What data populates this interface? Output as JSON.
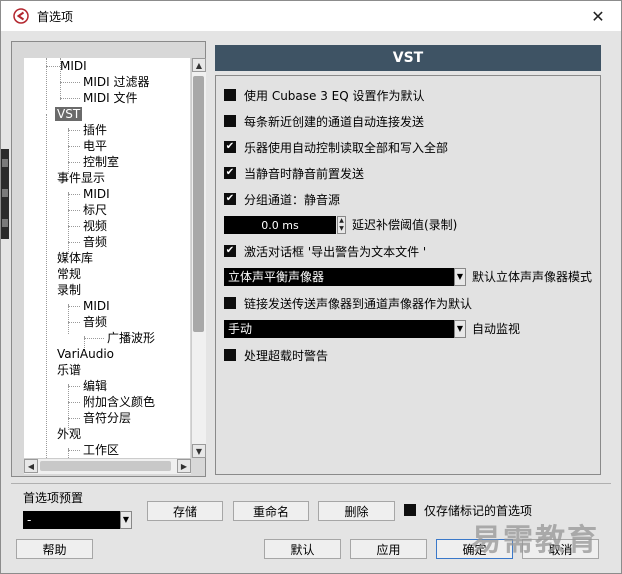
{
  "window": {
    "title": "首选项"
  },
  "tree": {
    "items": [
      "MIDI",
      "MIDI 过滤器",
      "MIDI 文件",
      "VST",
      "插件",
      "电平",
      "控制室",
      "事件显示",
      "MIDI",
      "标尺",
      "视频",
      "音频",
      "媒体库",
      "常规",
      "录制",
      "MIDI",
      "音频",
      "广播波形",
      "VariAudio",
      "乐谱",
      "编辑",
      "附加含义颜色",
      "音符分层",
      "外观",
      "工作区"
    ]
  },
  "vst": {
    "header": "VST",
    "opt1": "使用 Cubase 3 EQ 设置作为默认",
    "opt2": "每条新近创建的通道自动连接发送",
    "opt3": "乐器使用自动控制读取全部和写入全部",
    "opt4": "当静音时静音前置发送",
    "opt5": "分组通道：静音源",
    "delay_value": "0.0 ms",
    "delay_label": "延迟补偿阈值(录制)",
    "opt6": "激活对话框 '导出警告为文本文件 '",
    "panner_value": "立体声平衡声像器",
    "panner_label": "默认立体声声像器模式",
    "opt7": "链接发送传送声像器到通道声像器作为默认",
    "monitor_value": "手动",
    "monitor_label": "自动监视",
    "opt8": "处理超载时警告",
    "checked": {
      "opt1": false,
      "opt2": false,
      "opt3": true,
      "opt4": true,
      "opt5": true,
      "opt6": true,
      "opt7": false,
      "opt8": false
    }
  },
  "presets": {
    "label": "首选项预置",
    "value": "-",
    "store": "存储",
    "rename": "重命名",
    "delete": "删除",
    "only_marked": "仅存储标记的首选项"
  },
  "buttons": {
    "help": "帮助",
    "default": "默认",
    "apply": "应用",
    "ok": "确定",
    "cancel": "取消"
  },
  "watermark": "易需教育",
  "icons": {
    "app": "cubase-logo-icon",
    "close": "close-icon"
  },
  "colors": {
    "header_bg": "#3e5364",
    "selected_bg": "#6a6a6a"
  }
}
